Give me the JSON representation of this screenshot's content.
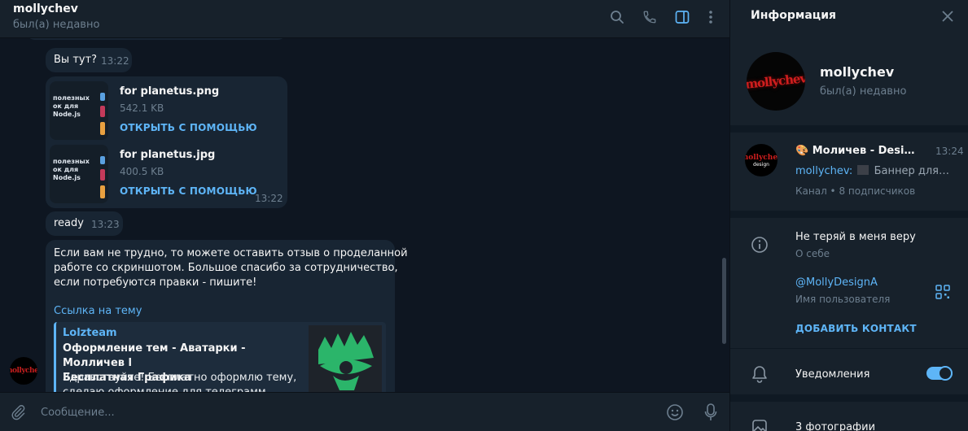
{
  "chat": {
    "peer_name": "mollychev",
    "peer_status": "был(а) недавно",
    "messages": {
      "m1": {
        "text": "Вы тут?",
        "time": "13:22"
      },
      "files": [
        {
          "name": "for planetus.png",
          "size": "542.1 KB",
          "action": "ОТКРЫТЬ С ПОМОЩЬЮ"
        },
        {
          "name": "for planetus.jpg",
          "size": "400.5 KB",
          "action": "ОТКРЫТЬ С ПОМОЩЬЮ"
        }
      ],
      "files_time": "13:22",
      "m2": {
        "text": "ready",
        "time": "13:23"
      },
      "m3": {
        "line1": "Если вам не трудно, то можете оставить отзыв о проделанной",
        "line2": "работе со скриншотом. Большое спасибо за сотрудничество,",
        "line3": "если потребуются правки - пишите!",
        "link": "Ссылка на тему",
        "preview": {
          "site": "Lolzteam",
          "title_line1": "Оформление тем - Аватарки - Молличев l",
          "title_line2": "Бесплатная Графика",
          "desc_line1": "Здравствуйте! Бесплатно оформлю тему,",
          "desc_line2": "сделаю оформление для телеграмм канала"
        }
      },
      "thumb_lines": [
        "полезных",
        "ок для",
        "Node.js"
      ]
    },
    "avatar_text": "mollychev",
    "composer_placeholder": "Сообщение..."
  },
  "info": {
    "title": "Информация",
    "name": "mollychev",
    "status": "был(а) недавно",
    "avatar_text": "mollychev",
    "channel": {
      "avatar_top": "mollychev",
      "avatar_bottom": "design",
      "name": "🎨 Моличев - Design Studio",
      "time": "13:24",
      "msg_author": "mollychev:",
      "msg_text": "Баннер для телеграм",
      "sub": "Канал • 8 подписчиков"
    },
    "bio": {
      "value": "Не теряй в меня веру",
      "label": "О себе"
    },
    "username": {
      "value": "@MollyDesignA",
      "label": "Имя пользователя"
    },
    "add_contact": "ДОБАВИТЬ КОНТАКТ",
    "notifications": {
      "label": "Уведомления",
      "enabled": true
    },
    "photos": {
      "label": "3 фотографии"
    }
  },
  "colors": {
    "accent": "#5eb5f7",
    "bg": "#0e1621",
    "panel": "#17212b",
    "bubble": "#182533"
  }
}
